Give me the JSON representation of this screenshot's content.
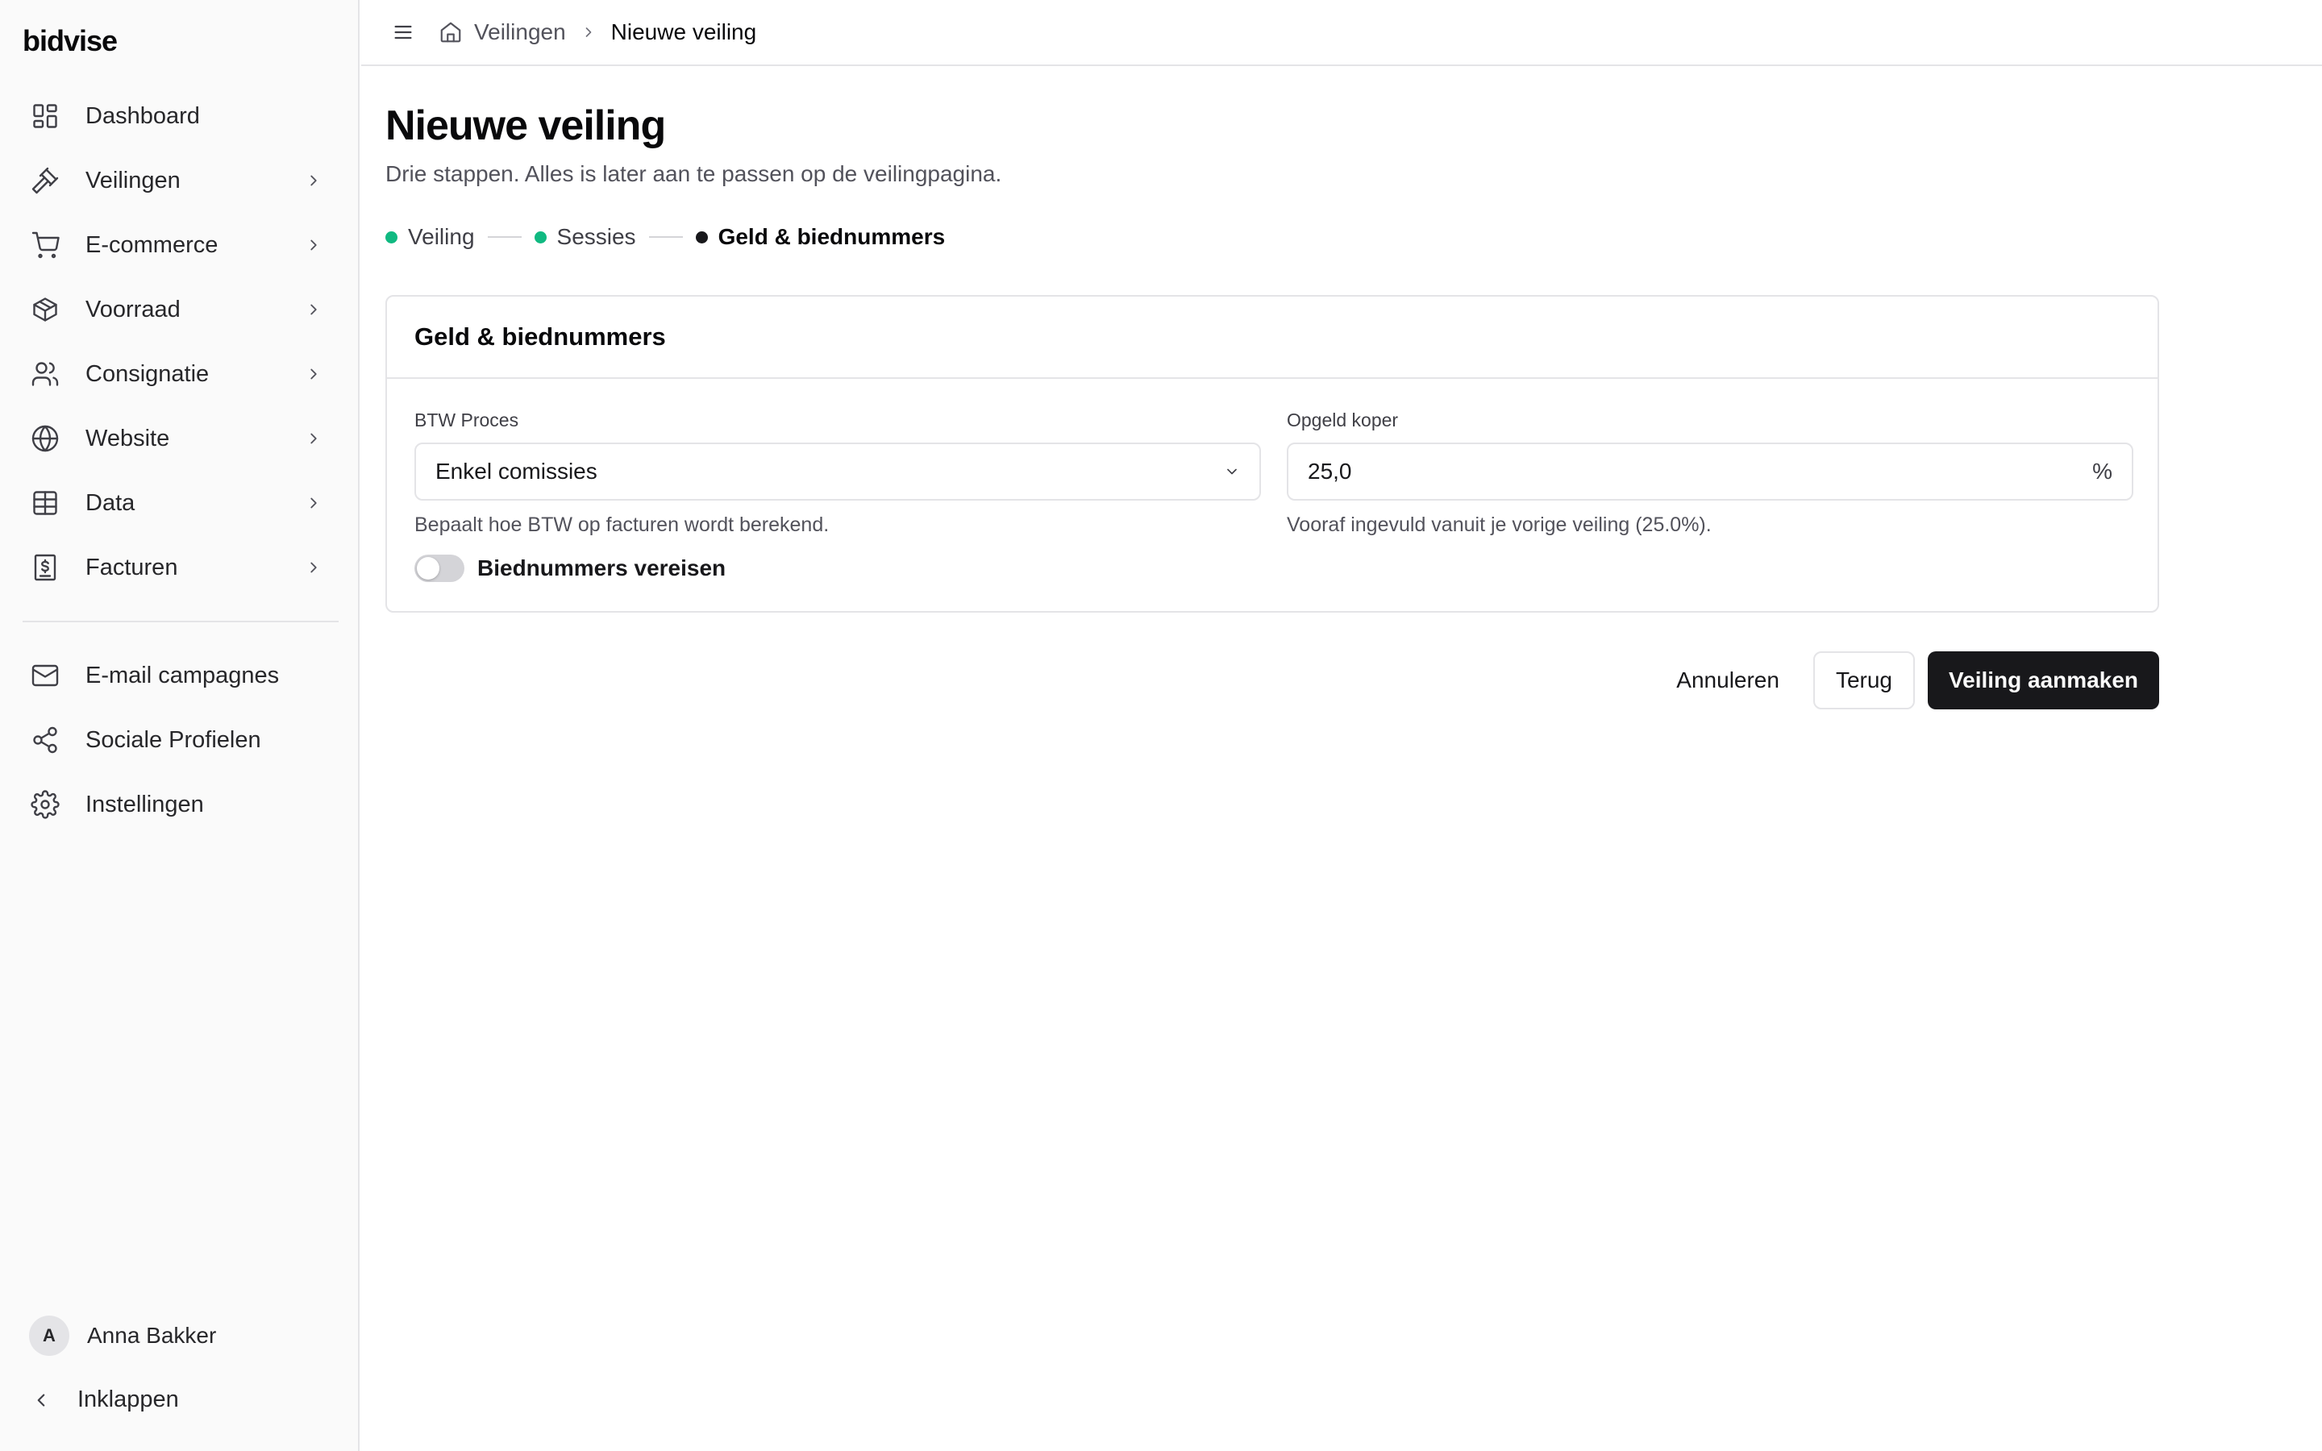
{
  "app": {
    "logo": "bidvise"
  },
  "sidebar": {
    "items": [
      {
        "label": "Dashboard",
        "icon": "dashboard-icon"
      },
      {
        "label": "Veilingen",
        "icon": "gavel-icon"
      },
      {
        "label": "E-commerce",
        "icon": "cart-icon"
      },
      {
        "label": "Voorraad",
        "icon": "package-icon"
      },
      {
        "label": "Consignatie",
        "icon": "users-icon"
      },
      {
        "label": "Website",
        "icon": "globe-icon"
      },
      {
        "label": "Data",
        "icon": "table-icon"
      },
      {
        "label": "Facturen",
        "icon": "receipt-icon"
      }
    ],
    "secondary": [
      {
        "label": "E-mail campagnes",
        "icon": "mail-icon"
      },
      {
        "label": "Sociale Profielen",
        "icon": "share-icon"
      },
      {
        "label": "Instellingen",
        "icon": "gear-icon"
      }
    ],
    "user": {
      "initial": "A",
      "name": "Anna Bakker"
    },
    "collapse_label": "Inklappen"
  },
  "breadcrumb": {
    "parent": "Veilingen",
    "current": "Nieuwe veiling"
  },
  "page": {
    "title": "Nieuwe veiling",
    "subtitle": "Drie stappen. Alles is later aan te passen op de veilingpagina."
  },
  "steps": [
    {
      "label": "Veiling",
      "state": "done"
    },
    {
      "label": "Sessies",
      "state": "done"
    },
    {
      "label": "Geld & biednummers",
      "state": "current"
    }
  ],
  "card": {
    "title": "Geld & biednummers",
    "vat": {
      "label": "BTW Proces",
      "value": "Enkel comissies",
      "help": "Bepaalt hoe BTW op facturen wordt berekend."
    },
    "premium": {
      "label": "Opgeld koper",
      "value": "25,0",
      "suffix": "%",
      "help": "Vooraf ingevuld vanuit je vorige veiling (25.0%)."
    },
    "bidnumbers": {
      "label": "Biednummers vereisen",
      "enabled": false
    }
  },
  "actions": {
    "cancel": "Annuleren",
    "back": "Terug",
    "create": "Veiling aanmaken"
  },
  "colors": {
    "accent": "#18181b",
    "step_done": "#10b981",
    "border": "#e4e4e7"
  }
}
